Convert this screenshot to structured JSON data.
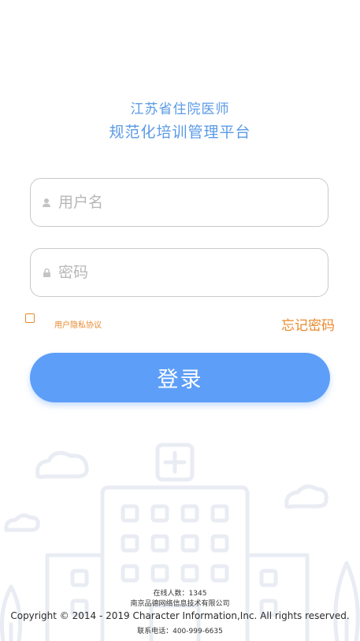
{
  "header": {
    "title_line1": "江苏省住院医师",
    "title_line2": "规范化培训管理平台"
  },
  "form": {
    "username_placeholder": "用户名",
    "password_placeholder": "密码",
    "agreement_label": "用户隐私协议",
    "forgot_password": "忘记密码",
    "login_button": "登录"
  },
  "footer": {
    "online_count": "在线人数：1345",
    "company": "南京品德网络信息技术有限公司",
    "copyright": "Copyright © 2014 - 2019 Character Information,Inc. All rights reserved.",
    "phone": "联系电话：400-999-6635"
  },
  "colors": {
    "accent_blue": "#5d9ef8",
    "title_blue": "#5a9ae6",
    "orange": "#e8892d",
    "illustration": "#e9ecf3"
  },
  "icons": {
    "username": "user-icon",
    "password": "lock-icon"
  }
}
